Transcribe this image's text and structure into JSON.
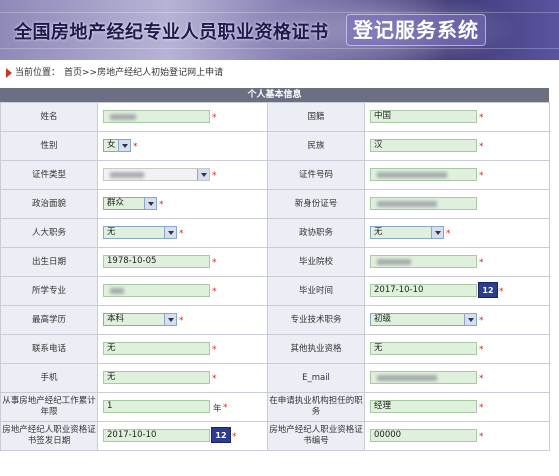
{
  "banner": {
    "title_main": "全国房地产经纪专业人员职业资格证书",
    "title_sub": "登记服务系统"
  },
  "breadcrumb": {
    "label": "当前位置：",
    "home": "首页",
    "rest": ">>房地产经纪人初始登记网上申请"
  },
  "section_title": "个人基本信息",
  "form": {
    "name_label": "姓名",
    "nationality_label": "国籍",
    "nationality_value": "中国",
    "gender_label": "性别",
    "gender_value": "女",
    "ethnicity_label": "民族",
    "ethnicity_value": "汉",
    "id_type_label": "证件类型",
    "id_number_label": "证件号码",
    "political_label": "政治面貌",
    "political_value": "群众",
    "new_id_label": "新身份证号",
    "npc_label": "人大职务",
    "npc_value": "无",
    "cppcc_label": "政协职务",
    "cppcc_value": "无",
    "birth_label": "出生日期",
    "birth_value": "1978-10-05",
    "school_label": "毕业院校",
    "major_label": "所学专业",
    "grad_time_label": "毕业时间",
    "grad_time_value": "2017-10-10",
    "edu_label": "最高学历",
    "edu_value": "本科",
    "title_label": "专业技术职务",
    "title_value": "初级",
    "phone_label": "联系电话",
    "phone_value": "无",
    "other_qual_label": "其他执业资格",
    "other_qual_value": "无",
    "mobile_label": "手机",
    "mobile_value": "无",
    "email_label": "E_mail",
    "years_label": "从事房地产经纪工作累计年限",
    "years_value": "1",
    "years_unit": "年",
    "position_label": "在申请执业机构担任的职务",
    "position_value": "经理",
    "cert_date_label": "房地产经纪人职业资格证书签发日期",
    "cert_date_value": "2017-10-10",
    "cert_no_label": "房地产经纪人职业资格证书编号",
    "cert_no_value": "00000",
    "required_mark": "*",
    "calendar_glyph": "12"
  }
}
